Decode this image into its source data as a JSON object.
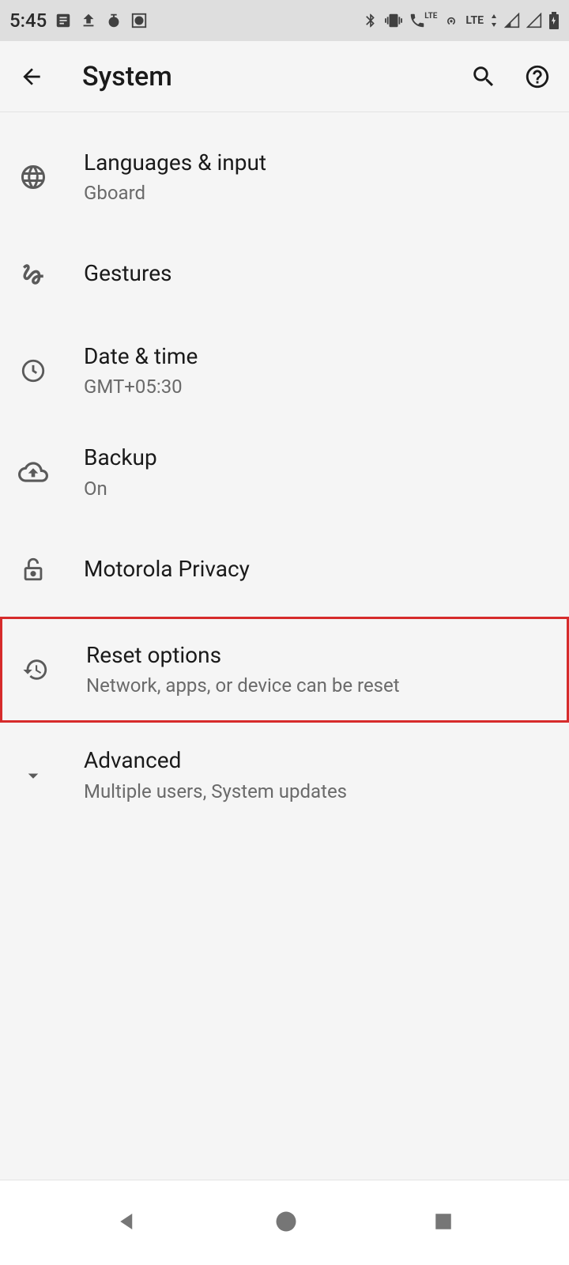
{
  "status": {
    "time": "5:45",
    "lte1": "LTE",
    "lte2": "LTE"
  },
  "appbar": {
    "title": "System"
  },
  "items": [
    {
      "title": "Languages & input",
      "subtitle": "Gboard"
    },
    {
      "title": "Gestures",
      "subtitle": null
    },
    {
      "title": "Date & time",
      "subtitle": "GMT+05:30"
    },
    {
      "title": "Backup",
      "subtitle": "On"
    },
    {
      "title": "Motorola Privacy",
      "subtitle": null
    },
    {
      "title": "Reset options",
      "subtitle": "Network, apps, or device can be reset"
    },
    {
      "title": "Advanced",
      "subtitle": "Multiple users, System updates"
    }
  ]
}
